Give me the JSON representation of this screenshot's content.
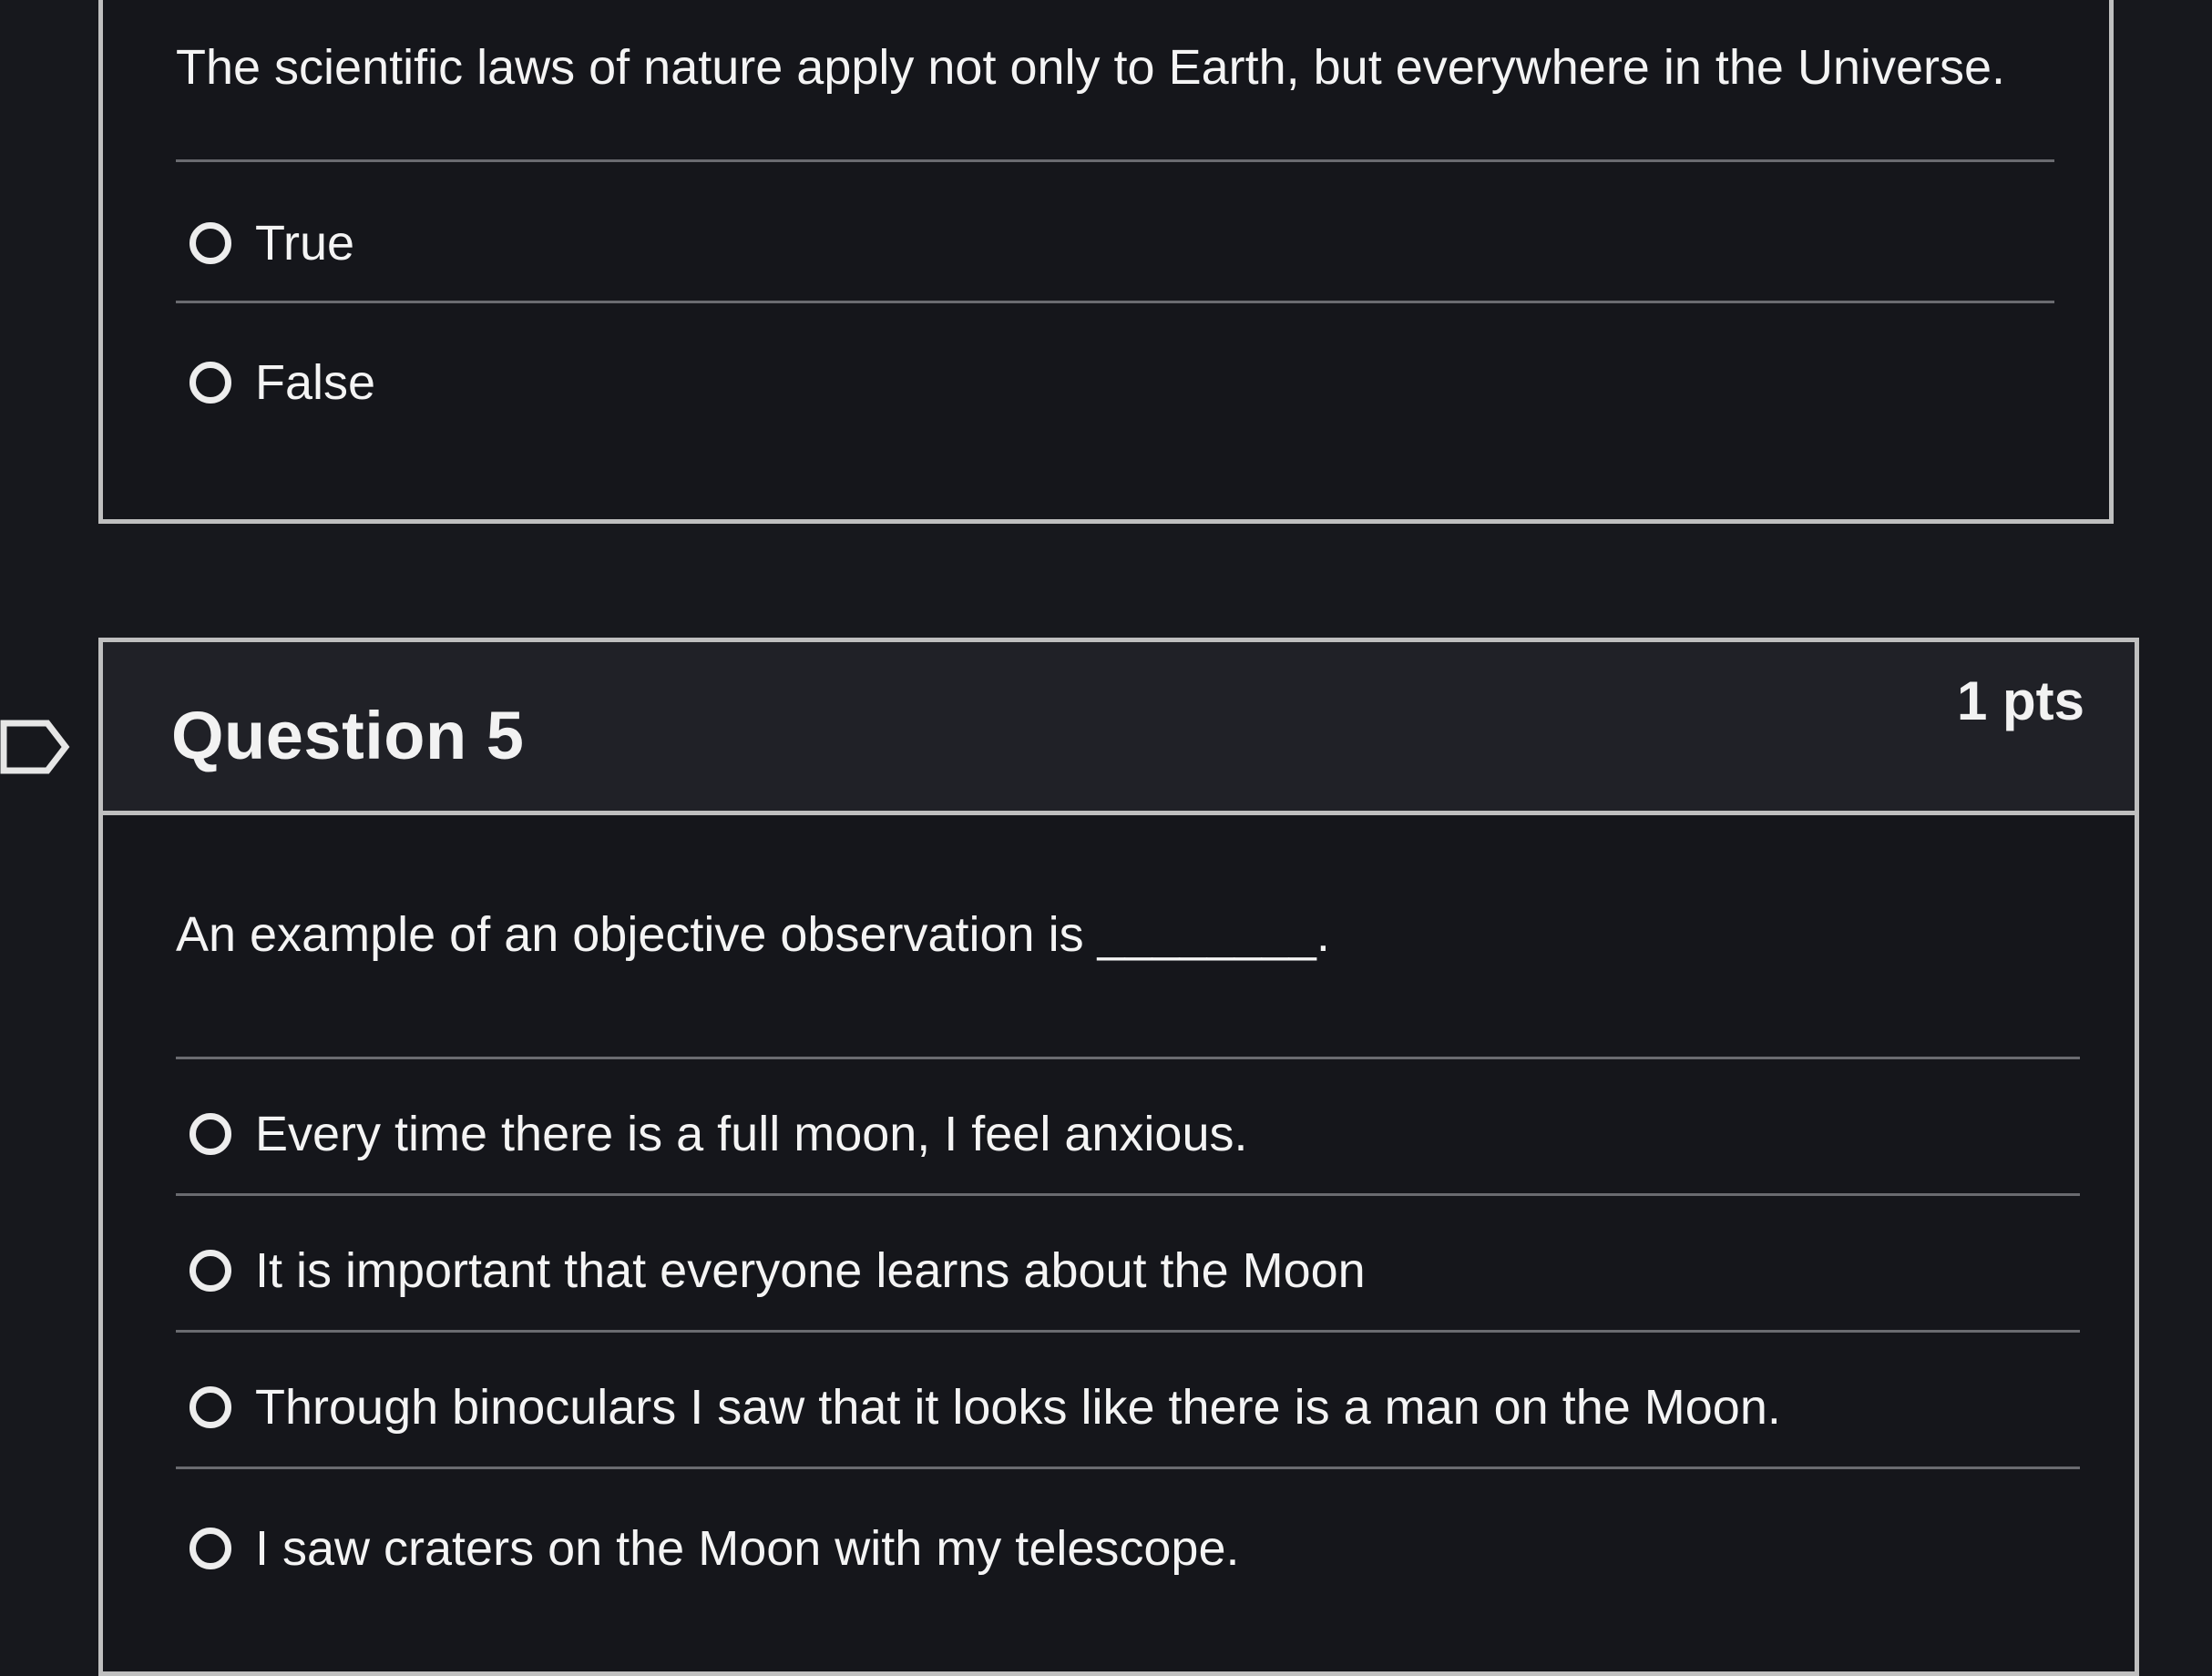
{
  "question4": {
    "text": "The scientific laws of nature apply not only to Earth, but everywhere in the Universe.",
    "answers": [
      {
        "label": "True"
      },
      {
        "label": "False"
      }
    ]
  },
  "question5": {
    "title": "Question 5",
    "points": "1 pts",
    "text": "An example of an objective observation is ________.",
    "answers": [
      {
        "label": "Every time there is a full moon, I feel anxious."
      },
      {
        "label": "It is important that everyone learns about the Moon"
      },
      {
        "label": "Through binoculars I saw that it looks like there is a man on the Moon."
      },
      {
        "label": "I saw craters on the Moon with my telescope."
      }
    ]
  },
  "icons": {
    "flag": "flag-question-icon",
    "radio": "radio-unselected-icon"
  }
}
